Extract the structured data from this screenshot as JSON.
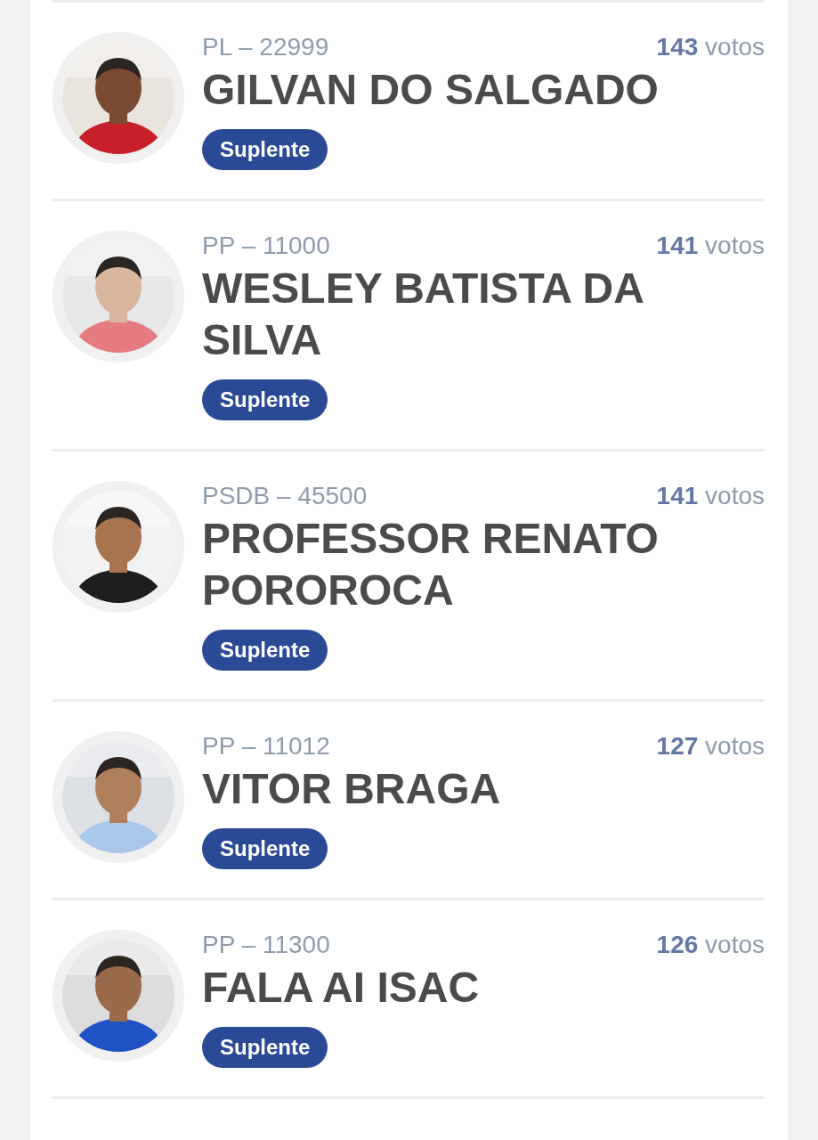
{
  "candidates": [
    {
      "party": "PL – 22999",
      "name": "GILVAN DO SALGADO",
      "votes": "143",
      "votes_unit": "votos",
      "status": "Suplente"
    },
    {
      "party": "PP – 11000",
      "name": "WESLEY BATISTA DA SILVA",
      "votes": "141",
      "votes_unit": "votos",
      "status": "Suplente"
    },
    {
      "party": "PSDB – 45500",
      "name": "PROFESSOR RENATO POROROCA",
      "votes": "141",
      "votes_unit": "votos",
      "status": "Suplente"
    },
    {
      "party": "PP – 11012",
      "name": "VITOR BRAGA",
      "votes": "127",
      "votes_unit": "votos",
      "status": "Suplente"
    },
    {
      "party": "PP – 11300",
      "name": "FALA AI ISAC",
      "votes": "126",
      "votes_unit": "votos",
      "status": "Suplente"
    }
  ]
}
